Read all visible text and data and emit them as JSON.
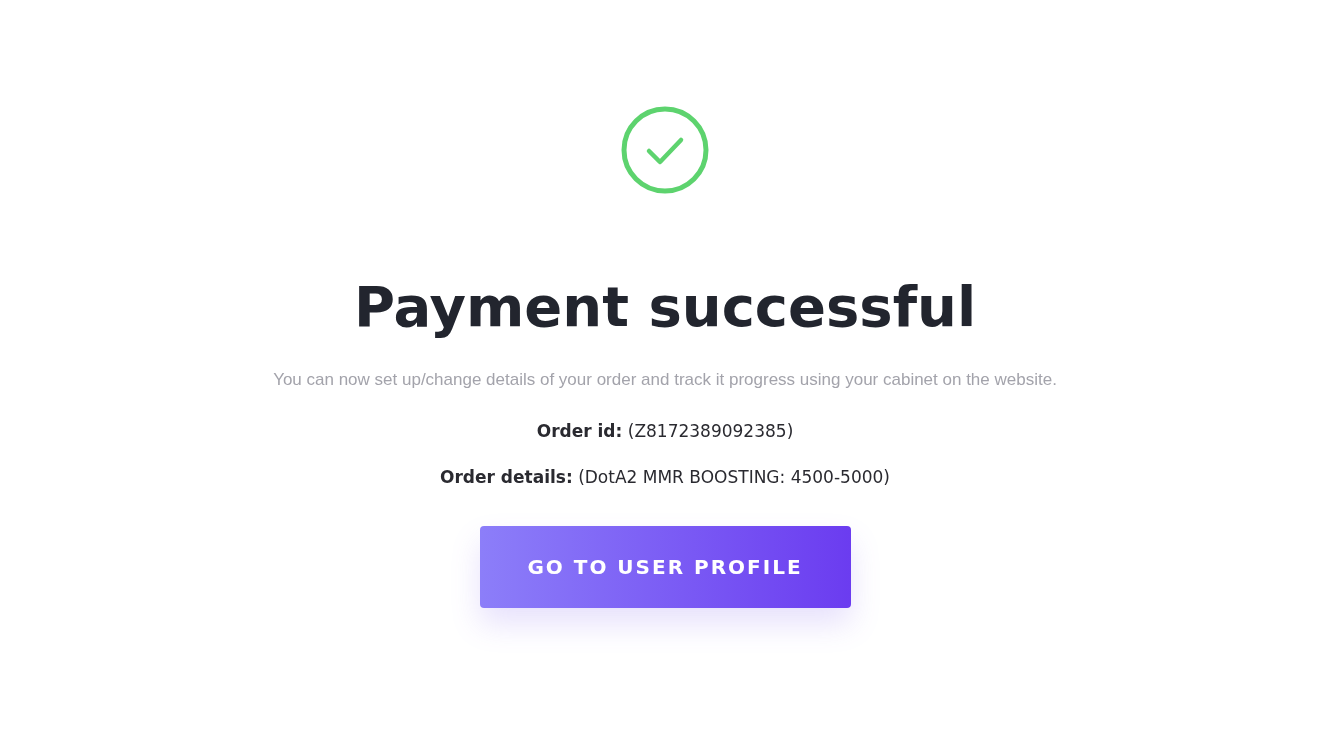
{
  "status": {
    "kind": "success"
  },
  "title": "Payment successful",
  "message": "You can now set up/change details of your order and track it progress using your cabinet on the website.",
  "details": [
    {
      "text": "**Order id:** (Z8172389092385)"
    },
    {
      "text": "**Order details:** (DotA2 MMR BOOSTING: 4500-5000)"
    }
  ],
  "button": {
    "label": "GO TO USER PROFILE"
  }
}
